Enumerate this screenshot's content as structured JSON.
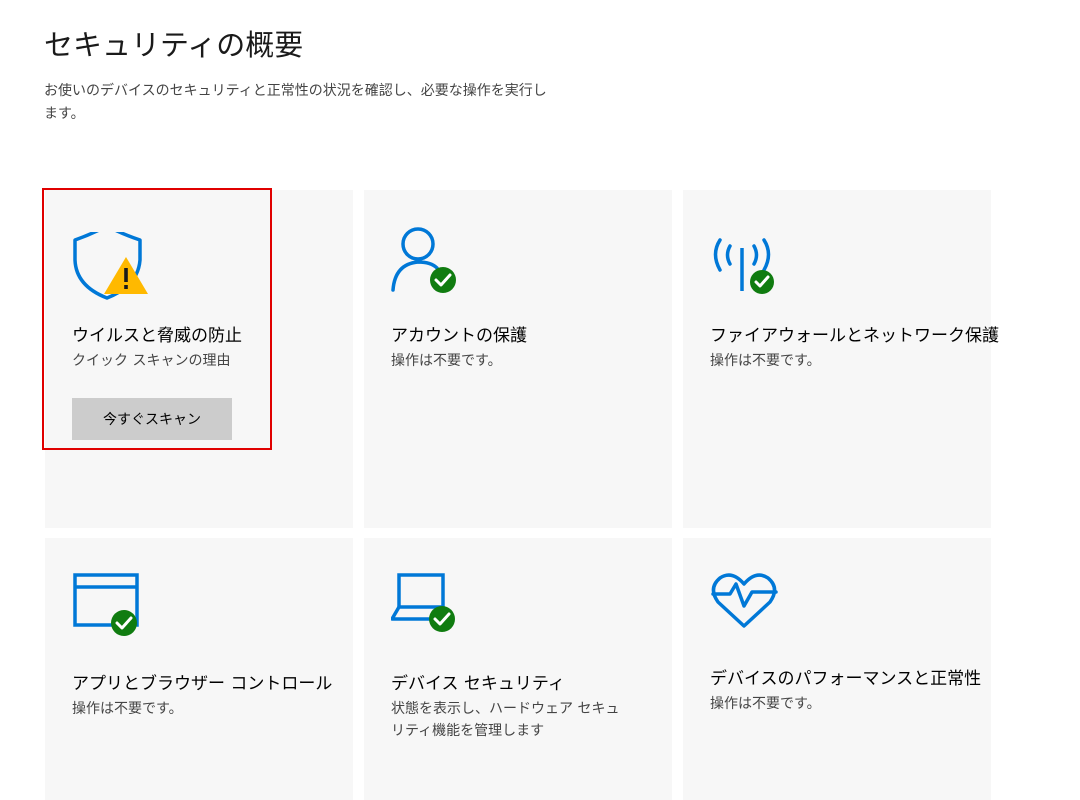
{
  "page": {
    "title": "セキュリティの概要",
    "description": "お使いのデバイスのセキュリティと正常性の状況を確認し、必要な操作を実行します。"
  },
  "colors": {
    "accent": "#0078d7",
    "ok": "#107c10",
    "warning": "#ffb900",
    "tile_bg": "#f7f7f7",
    "button_bg": "#cccccc",
    "highlight": "#e00000"
  },
  "tiles": [
    {
      "icon": "shield-warning-icon",
      "title": "ウイルスと脅威の防止",
      "status": "クイック スキャンの理由",
      "button": "今すぐスキャン"
    },
    {
      "icon": "person-check-icon",
      "title": "アカウントの保護",
      "status": "操作は不要です。"
    },
    {
      "icon": "wireless-check-icon",
      "title": "ファイアウォールとネットワーク保護",
      "status": "操作は不要です。"
    },
    {
      "icon": "browser-window-check-icon",
      "title": "アプリとブラウザー コントロール",
      "status": "操作は不要です。"
    },
    {
      "icon": "laptop-check-icon",
      "title": "デバイス セキュリティ",
      "status": "状態を表示し、ハードウェア セキュリティ機能を管理します"
    },
    {
      "icon": "heart-pulse-icon",
      "title": "デバイスのパフォーマンスと正常性",
      "status": "操作は不要です。"
    }
  ]
}
